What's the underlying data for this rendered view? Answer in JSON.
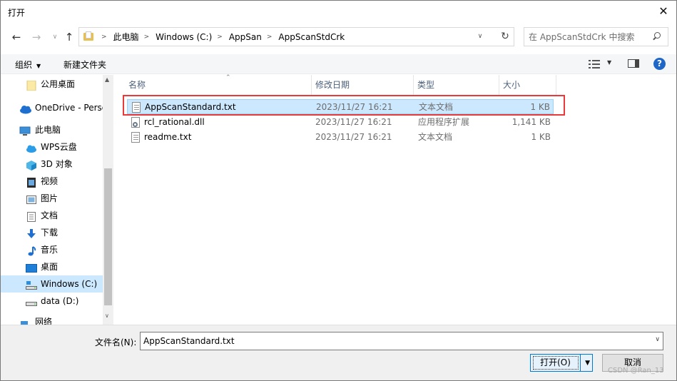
{
  "window": {
    "title": "打开",
    "close_glyph": "✕"
  },
  "nav": {
    "back_glyph": "←",
    "forward_glyph": "→",
    "recent_glyph": "∨",
    "up_glyph": "↑",
    "refresh_glyph": "↻",
    "dropdown_glyph": "∨",
    "breadcrumb": [
      "此电脑",
      "Windows (C:)",
      "AppSan",
      "AppScanStdCrk"
    ],
    "breadcrumb_sep": ">",
    "search_placeholder": "在 AppScanStdCrk 中搜索"
  },
  "toolbar": {
    "organize_label": "组织",
    "organize_caret": "▼",
    "new_folder_label": "新建文件夹",
    "view_caret": "▼",
    "help_glyph": "?"
  },
  "sidebar": {
    "items": [
      {
        "label": "公用桌面",
        "icon": "folder-icon"
      },
      {
        "label": "OneDrive - Perso",
        "icon": "cloud-icon"
      },
      {
        "label": "此电脑",
        "icon": "computer-icon"
      },
      {
        "label": "WPS云盘",
        "icon": "cloud-icon"
      },
      {
        "label": "3D 对象",
        "icon": "cube-icon"
      },
      {
        "label": "视频",
        "icon": "video-icon"
      },
      {
        "label": "图片",
        "icon": "picture-icon"
      },
      {
        "label": "文档",
        "icon": "document-icon"
      },
      {
        "label": "下载",
        "icon": "download-icon"
      },
      {
        "label": "音乐",
        "icon": "music-icon"
      },
      {
        "label": "桌面",
        "icon": "desktop-icon"
      },
      {
        "label": "Windows (C:)",
        "icon": "drive-icon",
        "selected": true
      },
      {
        "label": "data (D:)",
        "icon": "drive-icon"
      },
      {
        "label": "网络",
        "icon": "network-icon"
      }
    ],
    "scroll_up_glyph": "▲",
    "scroll_down_glyph": "∨"
  },
  "filelist": {
    "columns": [
      "名称",
      "修改日期",
      "类型",
      "大小"
    ],
    "sort_glyph": "⌃",
    "rows": [
      {
        "name": "AppScanStandard.txt",
        "date": "2023/11/27 16:21",
        "type": "文本文档",
        "size": "1 KB",
        "icon": "text-file-icon",
        "selected": true
      },
      {
        "name": "rcl_rational.dll",
        "date": "2023/11/27 16:21",
        "type": "应用程序扩展",
        "size": "1,141 KB",
        "icon": "dll-file-icon",
        "selected": false
      },
      {
        "name": "readme.txt",
        "date": "2023/11/27 16:21",
        "type": "文本文档",
        "size": "1 KB",
        "icon": "text-file-icon",
        "selected": false
      }
    ]
  },
  "bottom": {
    "filename_label": "文件名(N):",
    "filename_value": "AppScanStandard.txt",
    "dropdown_glyph": "∨",
    "open_label": "打开(O)",
    "open_dd_glyph": "▼",
    "cancel_label": "取消",
    "watermark": "CSDN @Ran_13"
  },
  "colors": {
    "selection": "#cce8ff",
    "selection_border": "#99d1ff",
    "highlight_annotation": "#e83a3a",
    "help_icon": "#1e66c8",
    "primary_button_border": "#0078d7"
  }
}
